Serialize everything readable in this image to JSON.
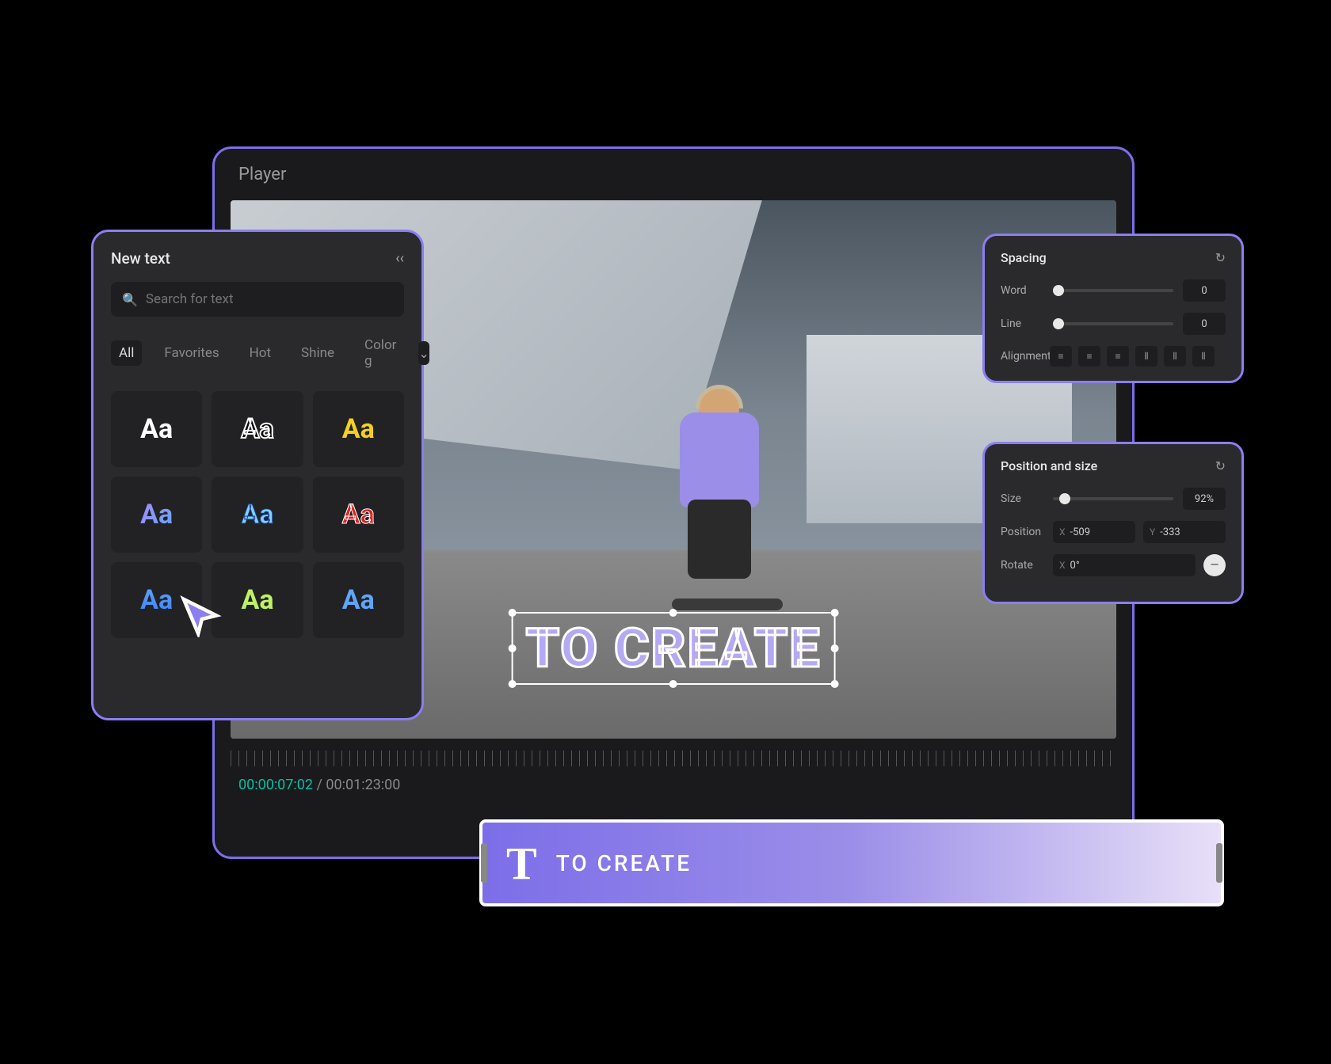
{
  "player": {
    "title": "Player"
  },
  "overlay": {
    "text": "TO CREATE"
  },
  "timeline": {
    "current": "00:00:07:02",
    "total": "00:01:23:00"
  },
  "textPanel": {
    "title": "New text",
    "searchPlaceholder": "Search for text",
    "tabs": [
      "All",
      "Favorites",
      "Hot",
      "Shine",
      "Color g"
    ],
    "activeTab": "All",
    "sample": "Aa"
  },
  "spacing": {
    "title": "Spacing",
    "word": {
      "label": "Word",
      "value": "0"
    },
    "line": {
      "label": "Line",
      "value": "0"
    },
    "alignLabel": "Alignment"
  },
  "position": {
    "title": "Position and size",
    "size": {
      "label": "Size",
      "value": "92%"
    },
    "pos": {
      "label": "Position",
      "x": "-509",
      "y": "-333"
    },
    "rotate": {
      "label": "Rotate",
      "x": "0°"
    }
  },
  "clip": {
    "icon": "T",
    "text": "TO CREATE"
  }
}
